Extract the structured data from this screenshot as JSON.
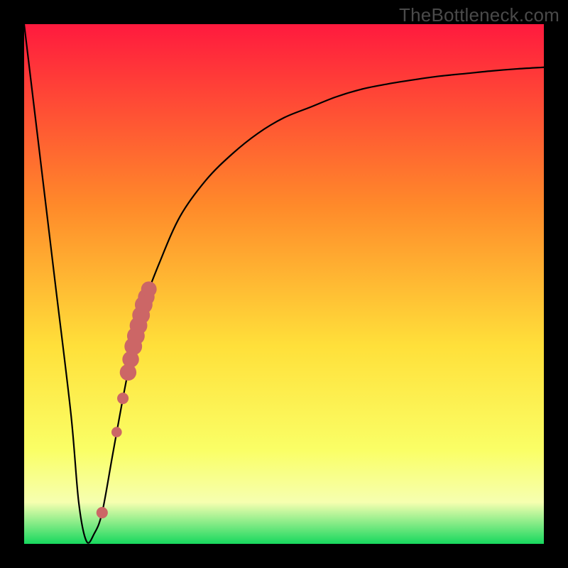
{
  "watermark": "TheBottleneck.com",
  "colors": {
    "frame": "#000000",
    "curve": "#000000",
    "marker": "#cc6666",
    "grad_top": "#ff1a3e",
    "grad_mid1": "#ff8a2a",
    "grad_mid2": "#ffe03a",
    "grad_mid3": "#faff66",
    "grad_band": "#f6ffb0",
    "grad_bottom": "#17d85e"
  },
  "chart_data": {
    "type": "line",
    "title": "",
    "xlabel": "",
    "ylabel": "",
    "xlim": [
      0,
      100
    ],
    "ylim": [
      0,
      100
    ],
    "x": [
      0,
      3,
      6,
      9,
      10.5,
      12,
      13.5,
      15,
      17,
      19,
      21,
      23,
      26,
      30,
      35,
      40,
      45,
      50,
      55,
      60,
      65,
      70,
      75,
      80,
      85,
      90,
      95,
      100
    ],
    "y": [
      100,
      75,
      50,
      25,
      8,
      0.5,
      2,
      6,
      17,
      28,
      38,
      46,
      54,
      63,
      70,
      75,
      79,
      82,
      84,
      86,
      87.5,
      88.5,
      89.3,
      90,
      90.5,
      91,
      91.4,
      91.7
    ],
    "markers": [
      {
        "x": 15.0,
        "y": 6.0,
        "r": 1.1
      },
      {
        "x": 17.8,
        "y": 21.5,
        "r": 1.0
      },
      {
        "x": 19.0,
        "y": 28.0,
        "r": 1.1
      },
      {
        "x": 20.0,
        "y": 33.0,
        "r": 1.6
      },
      {
        "x": 20.5,
        "y": 35.5,
        "r": 1.6
      },
      {
        "x": 21.0,
        "y": 38.0,
        "r": 1.7
      },
      {
        "x": 21.5,
        "y": 40.0,
        "r": 1.7
      },
      {
        "x": 22.0,
        "y": 42.0,
        "r": 1.7
      },
      {
        "x": 22.5,
        "y": 44.0,
        "r": 1.7
      },
      {
        "x": 23.0,
        "y": 46.0,
        "r": 1.7
      },
      {
        "x": 23.5,
        "y": 47.5,
        "r": 1.6
      },
      {
        "x": 24.0,
        "y": 49.0,
        "r": 1.5
      }
    ]
  }
}
